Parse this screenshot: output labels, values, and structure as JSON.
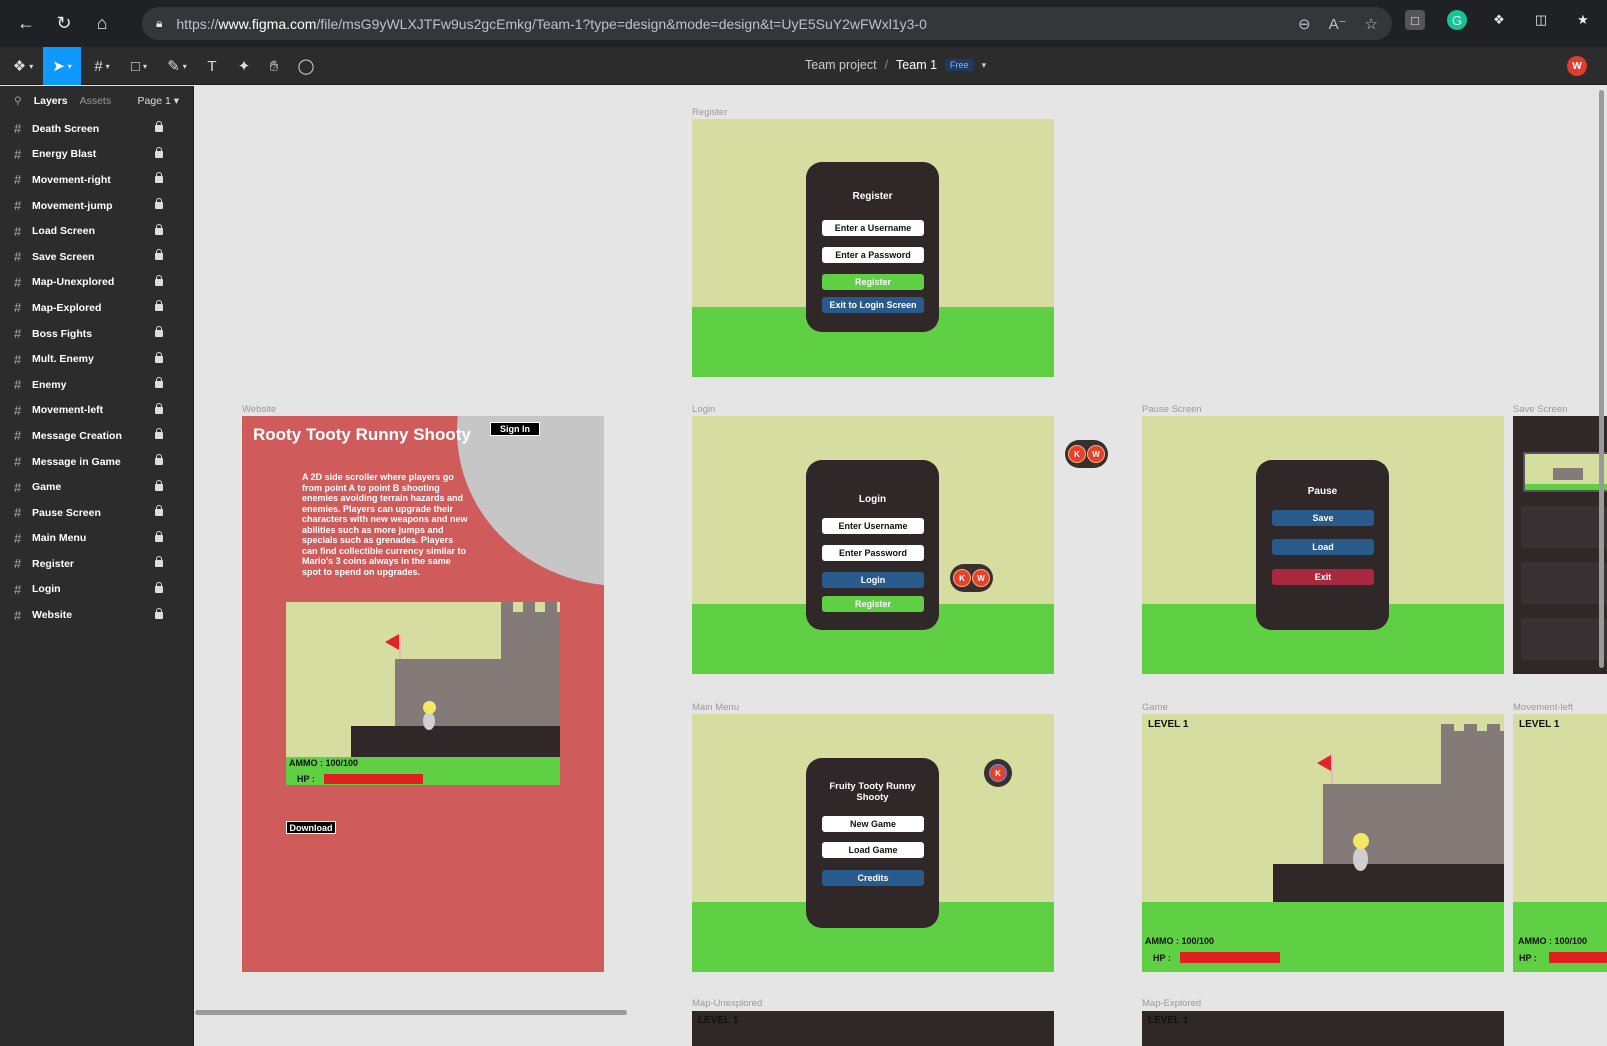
{
  "browser": {
    "url_prefix": "https://",
    "url_domain": "www.figma.com",
    "url_path": "/file/msG9yWLXJTFw9us2gcEmkg/Team-1?type=design&mode=design&t=UyE5SuY2wFWxl1y3-0"
  },
  "toolbar": {
    "project": "Team project",
    "separator": "/",
    "team": "Team 1",
    "plan_badge": "Free",
    "user_initial": "W"
  },
  "panel": {
    "tab_layers": "Layers",
    "tab_assets": "Assets",
    "page": "Page 1",
    "layers": [
      {
        "name": "Death Screen"
      },
      {
        "name": "Energy Blast"
      },
      {
        "name": "Movement-right"
      },
      {
        "name": "Movement-jump"
      },
      {
        "name": "Load Screen"
      },
      {
        "name": "Save Screen"
      },
      {
        "name": "Map-Unexplored"
      },
      {
        "name": "Map-Explored"
      },
      {
        "name": "Boss Fights"
      },
      {
        "name": "Mult. Enemy"
      },
      {
        "name": "Enemy"
      },
      {
        "name": "Movement-left"
      },
      {
        "name": "Message Creation"
      },
      {
        "name": "Message in Game"
      },
      {
        "name": "Game"
      },
      {
        "name": "Pause Screen"
      },
      {
        "name": "Main Menu"
      },
      {
        "name": "Register"
      },
      {
        "name": "Login"
      },
      {
        "name": "Website"
      }
    ]
  },
  "frames": {
    "register": {
      "label": "Register",
      "title": "Register",
      "username": "Enter a Username",
      "password": "Enter a Password",
      "register_btn": "Register",
      "exit_btn": "Exit to Login Screen"
    },
    "login": {
      "label": "Login",
      "title": "Login",
      "username": "Enter Username",
      "password": "Enter Password",
      "login_btn": "Login",
      "register_btn": "Register"
    },
    "pause": {
      "label": "Pause Screen",
      "title": "Pause",
      "save_btn": "Save",
      "load_btn": "Load",
      "exit_btn": "Exit"
    },
    "save_screen": {
      "label": "Save Screen"
    },
    "main_menu": {
      "label": "Main Menu",
      "title": "Fruity Tooty Runny Shooty",
      "new_game": "New Game",
      "load_game": "Load Game",
      "credits": "Credits"
    },
    "game": {
      "label": "Game",
      "level": "LEVEL 1",
      "ammo": "AMMO : 100/100",
      "hp": "HP :"
    },
    "movement_left": {
      "label": "Movement-left",
      "level": "LEVEL 1",
      "ammo": "AMMO : 100/100",
      "hp": "HP :"
    },
    "website": {
      "label": "Website",
      "title": "Rooty Tooty Runny Shooty",
      "sign_in": "Sign In",
      "description": "A 2D side scroller where players go from point A to point B shooting enemies avoiding terrain hazards and enemies. Players can upgrade their characters with new weapons and new abilities such as more jumps and specials such as grenades. Players can find collectible currency similar to Mario's 3 coins always in the same spot to spend on upgrades.",
      "ammo": "AMMO : 100/100",
      "hp": "HP :",
      "download": "Download"
    },
    "map_unexplored": {
      "label": "Map-Unexplored",
      "level": "LEVEL 1"
    },
    "map_explored": {
      "label": "Map-Explored",
      "level": "LEVEL 1"
    }
  },
  "collaborators": {
    "group1": [
      "K",
      "W"
    ],
    "group2": [
      "K",
      "W"
    ],
    "group3": [
      "K"
    ]
  },
  "colors": {
    "sky": "#d6dda0",
    "grass": "#5fd043",
    "phone": "#302729",
    "website_bg": "#cf5b5b",
    "figma_accent": "#0d99ff"
  }
}
